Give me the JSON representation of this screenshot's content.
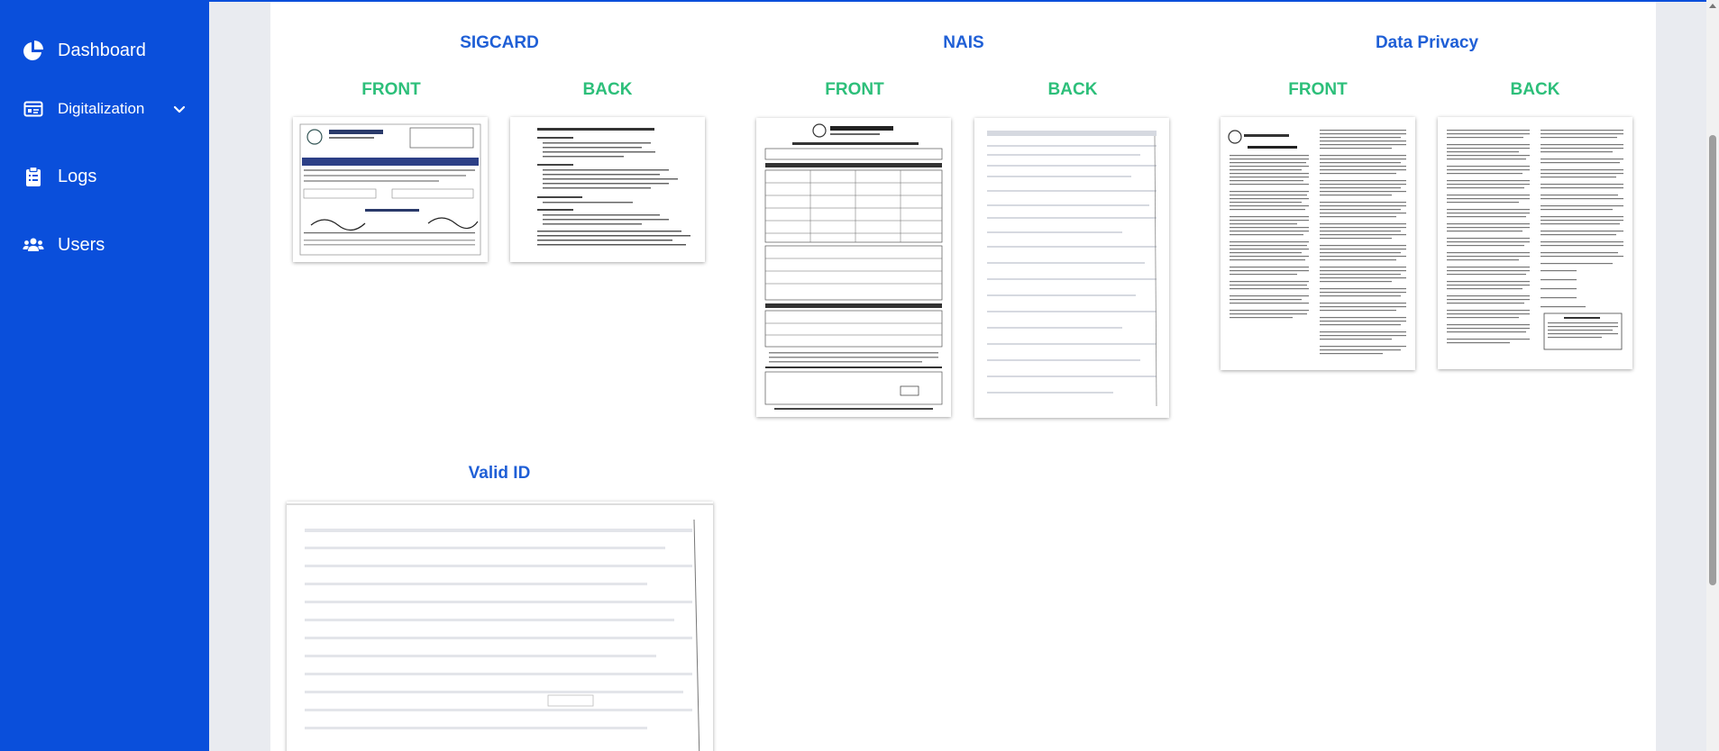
{
  "sidebar": {
    "items": [
      {
        "label": "Dashboard",
        "icon": "pie-chart-icon"
      },
      {
        "label": "Digitalization",
        "icon": "id-card-icon",
        "has_dropdown": true
      },
      {
        "label": "Logs",
        "icon": "clipboard-icon"
      },
      {
        "label": "Users",
        "icon": "users-icon"
      }
    ]
  },
  "sections": {
    "sigcard": {
      "title": "SIGCARD",
      "front_label": "FRONT",
      "back_label": "BACK"
    },
    "nais": {
      "title": "NAIS",
      "front_label": "FRONT",
      "back_label": "BACK"
    },
    "data_privacy": {
      "title": "Data Privacy",
      "front_label": "FRONT",
      "back_label": "BACK"
    },
    "valid_id": {
      "title": "Valid ID"
    }
  },
  "colors": {
    "sidebar": "#0a4fdb",
    "section_title": "#1f5fd6",
    "side_label": "#2dbf7a"
  }
}
